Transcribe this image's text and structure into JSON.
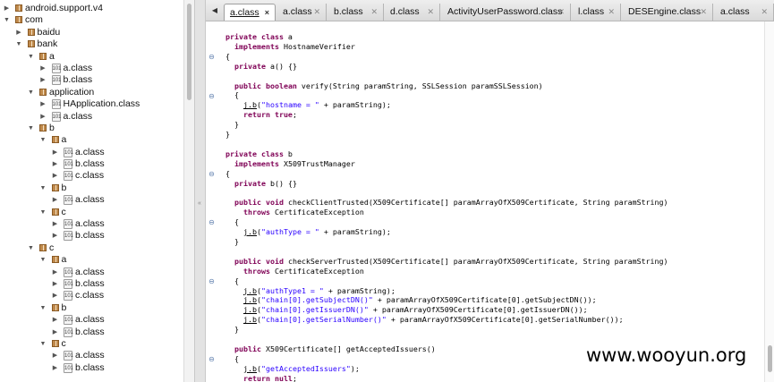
{
  "tree": {
    "items": [
      {
        "depth": 0,
        "open": false,
        "icon": "package-icon",
        "label": "android.support.v4"
      },
      {
        "depth": 0,
        "open": true,
        "icon": "package-icon",
        "label": "com"
      },
      {
        "depth": 1,
        "open": false,
        "icon": "package-icon",
        "label": "baidu"
      },
      {
        "depth": 1,
        "open": true,
        "icon": "package-icon",
        "label": "bank"
      },
      {
        "depth": 2,
        "open": true,
        "icon": "package-icon",
        "label": "a"
      },
      {
        "depth": 3,
        "open": false,
        "icon": "class-file-icon",
        "label": "a.class"
      },
      {
        "depth": 3,
        "open": false,
        "icon": "class-file-icon",
        "label": "b.class"
      },
      {
        "depth": 2,
        "open": true,
        "icon": "package-icon",
        "label": "application"
      },
      {
        "depth": 3,
        "open": false,
        "icon": "class-file-icon",
        "label": "HApplication.class"
      },
      {
        "depth": 3,
        "open": false,
        "icon": "class-file-icon",
        "label": "a.class"
      },
      {
        "depth": 2,
        "open": true,
        "icon": "package-icon",
        "label": "b"
      },
      {
        "depth": 3,
        "open": true,
        "icon": "package-icon",
        "label": "a"
      },
      {
        "depth": 4,
        "open": false,
        "icon": "class-file-icon",
        "label": "a.class"
      },
      {
        "depth": 4,
        "open": false,
        "icon": "class-file-icon",
        "label": "b.class"
      },
      {
        "depth": 4,
        "open": false,
        "icon": "class-file-icon",
        "label": "c.class"
      },
      {
        "depth": 3,
        "open": true,
        "icon": "package-icon",
        "label": "b"
      },
      {
        "depth": 4,
        "open": false,
        "icon": "class-file-icon",
        "label": "a.class"
      },
      {
        "depth": 3,
        "open": true,
        "icon": "package-icon",
        "label": "c"
      },
      {
        "depth": 4,
        "open": false,
        "icon": "class-file-icon",
        "label": "a.class"
      },
      {
        "depth": 4,
        "open": false,
        "icon": "class-file-icon",
        "label": "b.class"
      },
      {
        "depth": 2,
        "open": true,
        "icon": "package-icon",
        "label": "c"
      },
      {
        "depth": 3,
        "open": true,
        "icon": "package-icon",
        "label": "a"
      },
      {
        "depth": 4,
        "open": false,
        "icon": "class-file-icon",
        "label": "a.class"
      },
      {
        "depth": 4,
        "open": false,
        "icon": "class-file-icon",
        "label": "b.class"
      },
      {
        "depth": 4,
        "open": false,
        "icon": "class-file-icon",
        "label": "c.class"
      },
      {
        "depth": 3,
        "open": true,
        "icon": "package-icon",
        "label": "b"
      },
      {
        "depth": 4,
        "open": false,
        "icon": "class-file-icon",
        "label": "a.class"
      },
      {
        "depth": 4,
        "open": false,
        "icon": "class-file-icon",
        "label": "b.class"
      },
      {
        "depth": 3,
        "open": true,
        "icon": "package-icon",
        "label": "c"
      },
      {
        "depth": 4,
        "open": false,
        "icon": "class-file-icon",
        "label": "a.class"
      },
      {
        "depth": 4,
        "open": false,
        "icon": "class-file-icon",
        "label": "b.class"
      }
    ]
  },
  "tabs": [
    {
      "label": "a.class",
      "active": true
    },
    {
      "label": "a.class",
      "active": false
    },
    {
      "label": "b.class",
      "active": false
    },
    {
      "label": "d.class",
      "active": false
    },
    {
      "label": "ActivityUserPassword.class",
      "active": false
    },
    {
      "label": "l.class",
      "active": false
    },
    {
      "label": "DESEngine.class",
      "active": false
    },
    {
      "label": "a.class",
      "active": false
    }
  ],
  "icons": {
    "collapsed": "▶",
    "expanded": "▼",
    "tab_close": "✕",
    "tab_close_active": "×",
    "tab_nav": "◀",
    "fold": "⊖",
    "grip": "«",
    "class_glyph": "101"
  },
  "code_lines": [
    [
      {
        "t": "private class",
        "c": "kw"
      },
      {
        "t": " a"
      }
    ],
    [
      {
        "t": "  "
      },
      {
        "t": "implements",
        "c": "kw"
      },
      {
        "t": " HostnameVerifier"
      }
    ],
    [
      {
        "t": "{"
      }
    ],
    [
      {
        "t": "  "
      },
      {
        "t": "private",
        "c": "kw"
      },
      {
        "t": " a() {}"
      }
    ],
    [
      {
        "t": ""
      }
    ],
    [
      {
        "t": "  "
      },
      {
        "t": "public boolean",
        "c": "kw"
      },
      {
        "t": " verify(String paramString, SSLSession paramSSLSession)"
      }
    ],
    [
      {
        "t": "  {"
      }
    ],
    [
      {
        "t": "    "
      },
      {
        "t": "j.b",
        "c": "mcall"
      },
      {
        "t": "("
      },
      {
        "t": "\"hostname = \"",
        "c": "str"
      },
      {
        "t": " + paramString);"
      }
    ],
    [
      {
        "t": "    "
      },
      {
        "t": "return true",
        "c": "kw"
      },
      {
        "t": ";"
      }
    ],
    [
      {
        "t": "  }"
      }
    ],
    [
      {
        "t": "}"
      }
    ],
    [
      {
        "t": ""
      }
    ],
    [
      {
        "t": "private class",
        "c": "kw"
      },
      {
        "t": " b"
      }
    ],
    [
      {
        "t": "  "
      },
      {
        "t": "implements",
        "c": "kw"
      },
      {
        "t": " X509TrustManager"
      }
    ],
    [
      {
        "t": "{"
      }
    ],
    [
      {
        "t": "  "
      },
      {
        "t": "private",
        "c": "kw"
      },
      {
        "t": " b() {}"
      }
    ],
    [
      {
        "t": ""
      }
    ],
    [
      {
        "t": "  "
      },
      {
        "t": "public void",
        "c": "kw"
      },
      {
        "t": " checkClientTrusted(X509Certificate[] paramArrayOfX509Certificate, String paramString)"
      }
    ],
    [
      {
        "t": "    "
      },
      {
        "t": "throws",
        "c": "kw"
      },
      {
        "t": " CertificateException"
      }
    ],
    [
      {
        "t": "  {"
      }
    ],
    [
      {
        "t": "    "
      },
      {
        "t": "j.b",
        "c": "mcall"
      },
      {
        "t": "("
      },
      {
        "t": "\"authType = \"",
        "c": "str"
      },
      {
        "t": " + paramString);"
      }
    ],
    [
      {
        "t": "  }"
      }
    ],
    [
      {
        "t": ""
      }
    ],
    [
      {
        "t": "  "
      },
      {
        "t": "public void",
        "c": "kw"
      },
      {
        "t": " checkServerTrusted(X509Certificate[] paramArrayOfX509Certificate, String paramString)"
      }
    ],
    [
      {
        "t": "    "
      },
      {
        "t": "throws",
        "c": "kw"
      },
      {
        "t": " CertificateException"
      }
    ],
    [
      {
        "t": "  {"
      }
    ],
    [
      {
        "t": "    "
      },
      {
        "t": "j.b",
        "c": "mcall"
      },
      {
        "t": "("
      },
      {
        "t": "\"authType1 = \"",
        "c": "str"
      },
      {
        "t": " + paramString);"
      }
    ],
    [
      {
        "t": "    "
      },
      {
        "t": "j.b",
        "c": "mcall"
      },
      {
        "t": "("
      },
      {
        "t": "\"chain[0].getSubjectDN()\"",
        "c": "str"
      },
      {
        "t": " + paramArrayOfX509Certificate[0].getSubjectDN());"
      }
    ],
    [
      {
        "t": "    "
      },
      {
        "t": "j.b",
        "c": "mcall"
      },
      {
        "t": "("
      },
      {
        "t": "\"chain[0].getIssuerDN()\"",
        "c": "str"
      },
      {
        "t": " + paramArrayOfX509Certificate[0].getIssuerDN());"
      }
    ],
    [
      {
        "t": "    "
      },
      {
        "t": "j.b",
        "c": "mcall"
      },
      {
        "t": "("
      },
      {
        "t": "\"chain[0].getSerialNumber()\"",
        "c": "str"
      },
      {
        "t": " + paramArrayOfX509Certificate[0].getSerialNumber());"
      }
    ],
    [
      {
        "t": "  }"
      }
    ],
    [
      {
        "t": ""
      }
    ],
    [
      {
        "t": "  "
      },
      {
        "t": "public",
        "c": "kw"
      },
      {
        "t": " X509Certificate[] getAcceptedIssuers()"
      }
    ],
    [
      {
        "t": "  {"
      }
    ],
    [
      {
        "t": "    "
      },
      {
        "t": "j.b",
        "c": "mcall"
      },
      {
        "t": "("
      },
      {
        "t": "\"getAcceptedIssuers\"",
        "c": "str"
      },
      {
        "t": ");"
      }
    ],
    [
      {
        "t": "    "
      },
      {
        "t": "return null",
        "c": "kw"
      },
      {
        "t": ";"
      }
    ],
    [
      {
        "t": "  }"
      }
    ]
  ],
  "watermark": "www.wooyun.org",
  "colors": {
    "keyword": "#7f0055",
    "string": "#2a00ff",
    "current_line": "#e8f2fe",
    "package_icon": "#c08a4c",
    "fold_marker": "#5f7fae"
  }
}
